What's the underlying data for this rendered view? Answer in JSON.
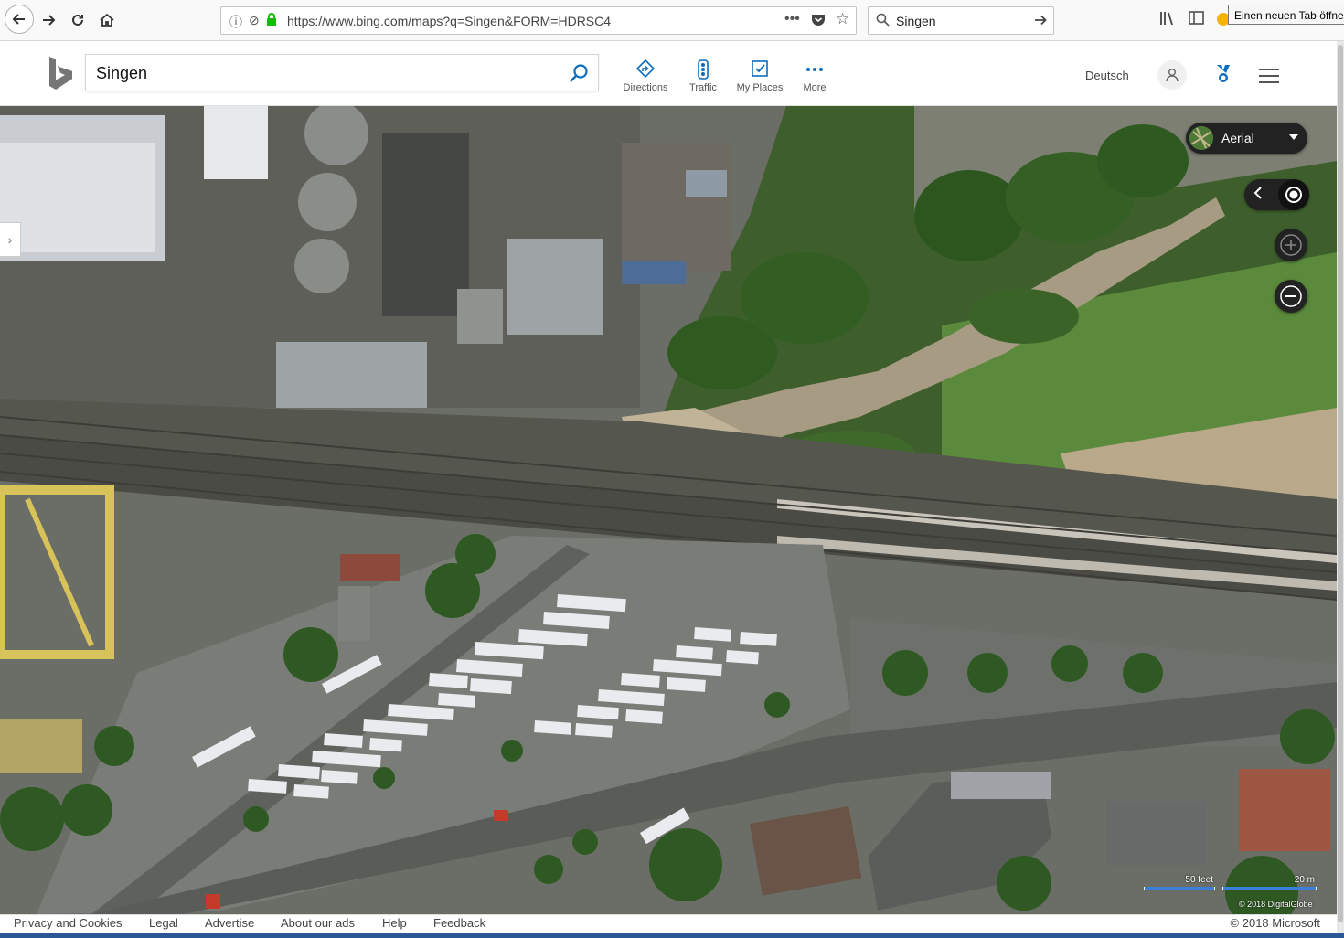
{
  "browser": {
    "url": "https://www.bing.com/maps?q=Singen&FORM=HDRSC4",
    "search_value": "Singen",
    "tooltip": "Einen neuen Tab öffne"
  },
  "bing": {
    "search_value": "Singen",
    "nav": [
      {
        "label": "Directions",
        "icon": "directions-icon"
      },
      {
        "label": "Traffic",
        "icon": "traffic-icon"
      },
      {
        "label": "My Places",
        "icon": "my-places-icon"
      },
      {
        "label": "More",
        "icon": "more-icon"
      }
    ],
    "language": "Deutsch"
  },
  "map": {
    "style_label": "Aerial",
    "scale_feet": "50 feet",
    "scale_meters": "20 m",
    "imagery_credit": "© 2018 DigitalGlobe"
  },
  "footer": {
    "links": [
      "Privacy and Cookies",
      "Legal",
      "Advertise",
      "About our ads",
      "Help",
      "Feedback"
    ],
    "copyright": "© 2018 Microsoft"
  },
  "colors": {
    "accent": "#0b6dbd",
    "map_control_bg": "#222222",
    "scale_bar": "#3b7fd6"
  }
}
